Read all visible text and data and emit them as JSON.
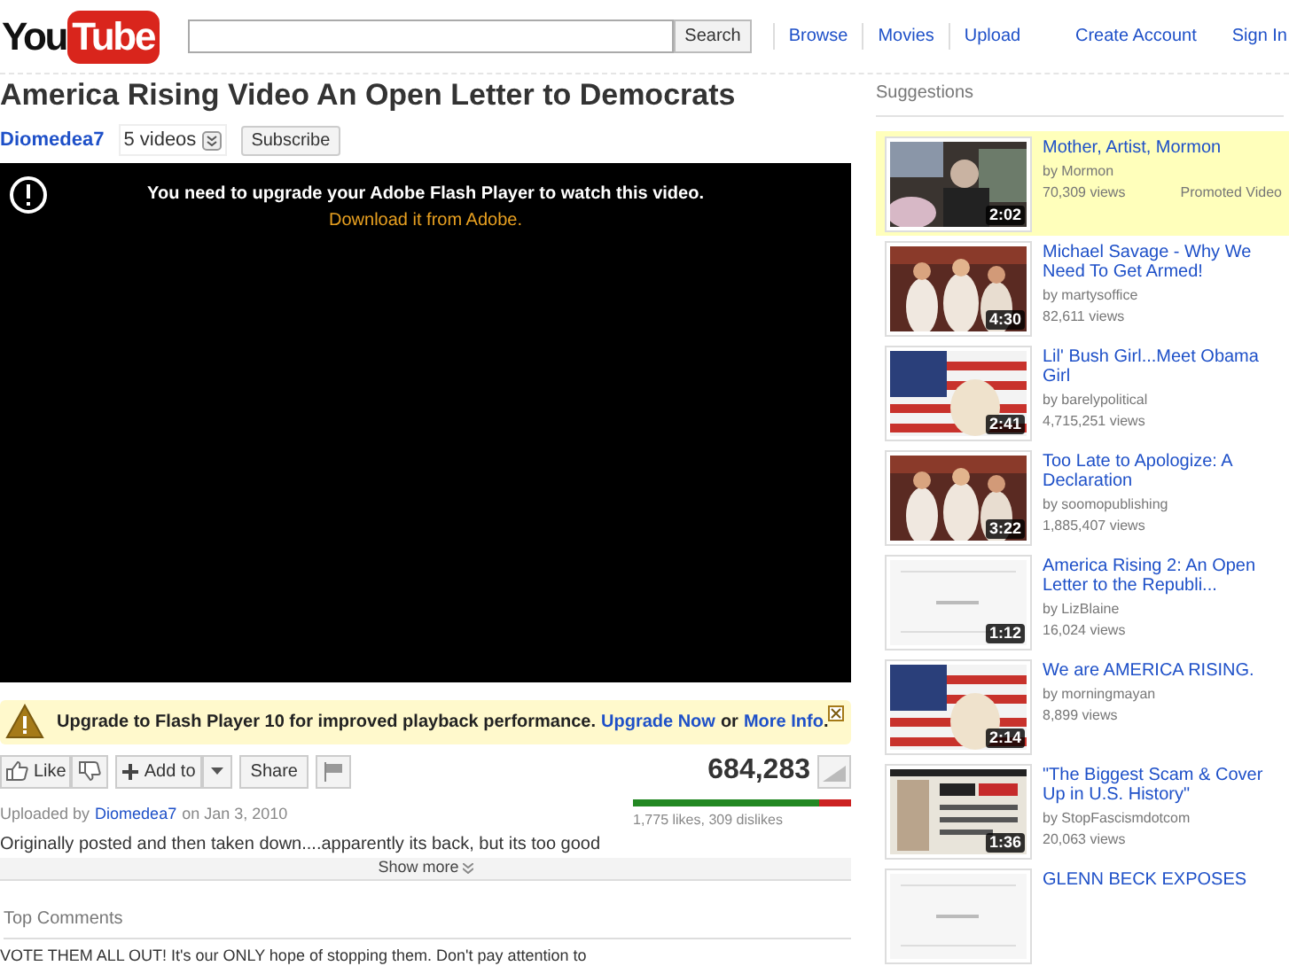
{
  "header": {
    "logo_you": "You",
    "logo_tube": "Tube",
    "search_button": "Search",
    "nav": [
      "Browse",
      "Movies",
      "Upload"
    ],
    "account_links": [
      "Create Account",
      "Sign In"
    ]
  },
  "video": {
    "title": "America Rising Video An Open Letter to Democrats",
    "channel": "Diomedea7",
    "video_count": "5 videos",
    "subscribe": "Subscribe",
    "player_message": "You need to upgrade your Adobe Flash Player to watch this video.",
    "player_link": "Download it from Adobe.",
    "notice": {
      "text": "Upgrade to Flash Player 10 for improved playback performance.",
      "link1": "Upgrade Now",
      "middle": "or",
      "link2": "More Info",
      "end": "."
    },
    "like": "Like",
    "add_to": "Add to",
    "share": "Share",
    "views": "684,283",
    "uploaded_prefix": "Uploaded by",
    "uploader": "Diomedea7",
    "uploaded_suffix": "on Jan 3, 2010",
    "ratings": {
      "level": 0.852,
      "text": "1,775 likes, 309 dislikes"
    },
    "description": "Originally posted and then taken down....apparently its back, but its too good",
    "show_more": "Show more"
  },
  "comments": {
    "heading": "Top Comments",
    "first": "VOTE THEM ALL OUT! It's our ONLY hope of stopping them. Don't pay attention to"
  },
  "suggestions": {
    "heading": "Suggestions",
    "items": [
      {
        "title": "Mother, Artist, Mormon",
        "by": "by Mormon",
        "views": "70,309 views",
        "duration": "2:02",
        "promoted": true,
        "promo_label": "Promoted Video"
      },
      {
        "title": "Michael Savage - Why We Need To Get Armed!",
        "by": "by martysoffice",
        "views": "82,611 views",
        "duration": "4:30",
        "promoted": false
      },
      {
        "title": "Lil' Bush Girl...Meet Obama Girl",
        "by": "by barelypolitical",
        "views": "4,715,251 views",
        "duration": "2:41",
        "promoted": false
      },
      {
        "title": "Too Late to Apologize: A Declaration",
        "by": "by soomopublishing",
        "views": "1,885,407 views",
        "duration": "3:22",
        "promoted": false
      },
      {
        "title": "America Rising 2: An Open Letter to the Republi...",
        "by": "by LizBlaine",
        "views": "16,024 views",
        "duration": "1:12",
        "promoted": false
      },
      {
        "title": "We are AMERICA RISING.",
        "by": "by morningmayan",
        "views": "8,899 views",
        "duration": "2:14",
        "promoted": false
      },
      {
        "title": "\"The Biggest Scam & Cover Up in U.S. History\"",
        "by": "by StopFascismdotcom",
        "views": "20,063 views",
        "duration": "1:36",
        "promoted": false
      },
      {
        "title": "GLENN BECK EXPOSES",
        "promoted": false
      }
    ]
  }
}
